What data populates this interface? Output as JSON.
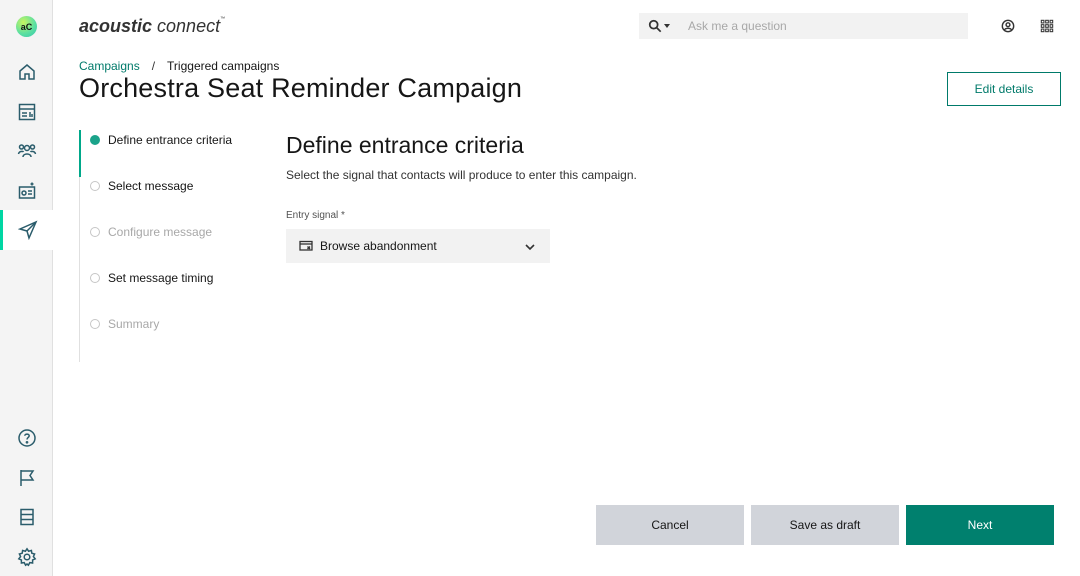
{
  "app": {
    "logo_text": "aC",
    "brand_bold": "acoustic",
    "brand_light": " connect",
    "brand_tm": "™"
  },
  "search": {
    "placeholder": "Ask me a question"
  },
  "icons": {
    "nav_top": [
      "home-icon",
      "dashboard-icon",
      "audience-icon",
      "content-icon",
      "campaigns-send-icon"
    ],
    "nav_bottom": [
      "help-icon",
      "flag-icon",
      "data-icon",
      "settings-icon"
    ],
    "header": [
      "user-icon",
      "app-grid-icon"
    ]
  },
  "colors": {
    "accent": "#007a6a",
    "primary_button": "#00806e",
    "active_rail": "#00d6a3"
  },
  "breadcrumb": {
    "parent": "Campaigns",
    "separator": "/",
    "current": "Triggered campaigns"
  },
  "page": {
    "title": "Orchestra Seat Reminder Campaign",
    "edit_label": "Edit details"
  },
  "steps": [
    {
      "label": "Define entrance criteria",
      "state": "current"
    },
    {
      "label": "Select message",
      "state": "incomplete"
    },
    {
      "label": "Configure message",
      "state": "disabled"
    },
    {
      "label": "Set message timing",
      "state": "incomplete"
    },
    {
      "label": "Summary",
      "state": "disabled"
    }
  ],
  "form": {
    "title": "Define entrance criteria",
    "description": "Select the signal that contacts will produce to enter this campaign.",
    "entry_signal_label": "Entry signal *",
    "entry_signal_value": "Browse abandonment"
  },
  "footer": {
    "cancel": "Cancel",
    "save_draft": "Save as draft",
    "next": "Next"
  }
}
